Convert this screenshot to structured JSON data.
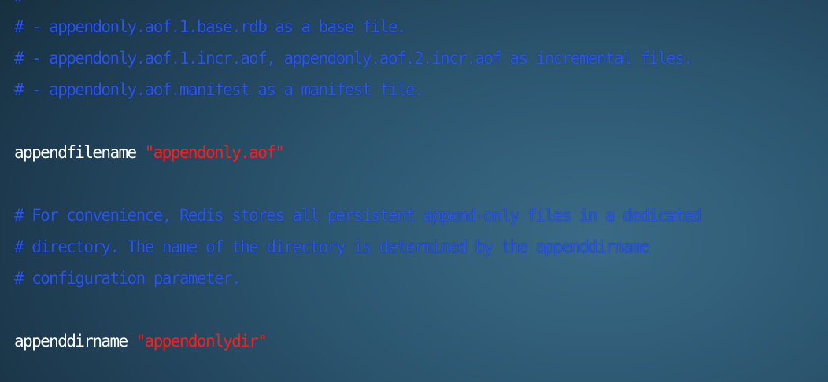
{
  "colors": {
    "comment": "#2a57e8",
    "directive": "#ffffff",
    "string": "#ff1d1d",
    "background": "#2c5670"
  },
  "lines": [
    {
      "type": "comment",
      "text": "#"
    },
    {
      "type": "comment",
      "text": "# - appendonly.aof.1.base.rdb as a base file."
    },
    {
      "type": "comment",
      "text": "# - appendonly.aof.1.incr.aof, appendonly.aof.2.incr.aof as incremental files."
    },
    {
      "type": "comment",
      "text": "# - appendonly.aof.manifest as a manifest file."
    },
    {
      "type": "blank",
      "text": ""
    },
    {
      "type": "directive",
      "key": "appendfilename",
      "value": "\"appendonly.aof\""
    },
    {
      "type": "blank",
      "text": ""
    },
    {
      "type": "comment",
      "text": "# For convenience, Redis stores all persistent append-only files in a dedicated"
    },
    {
      "type": "comment",
      "text": "# directory. The name of the directory is determined by the appenddirname"
    },
    {
      "type": "comment",
      "text": "# configuration parameter."
    },
    {
      "type": "blank",
      "text": ""
    },
    {
      "type": "directive",
      "key": "appenddirname",
      "value": "\"appendonlydir\""
    }
  ]
}
